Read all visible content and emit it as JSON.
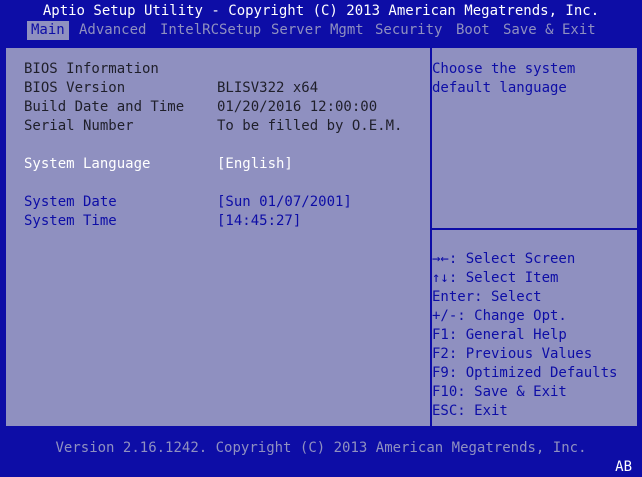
{
  "title": "Aptio Setup Utility - Copyright (C) 2013 American Megatrends, Inc.",
  "tabs": [
    "Main",
    "Advanced",
    "IntelRCSetup",
    "Server Mgmt",
    "Security",
    "Boot",
    "Save & Exit"
  ],
  "main": {
    "section_header": "BIOS Information",
    "bios_version_label": "BIOS Version",
    "bios_version_value": "BLISV322 x64",
    "build_date_label": "Build Date and Time",
    "build_date_value": "01/20/2016 12:00:00",
    "serial_label": "Serial Number",
    "serial_value": "To be filled by O.E.M.",
    "language_label": "System Language",
    "language_value": "[English]",
    "date_label": "System Date",
    "date_value": "[Sun 01/07/2001]",
    "time_label": "System Time",
    "time_value": "[14:45:27]"
  },
  "help": {
    "line1": "Choose the system",
    "line2": "default language"
  },
  "keys": [
    "→←: Select Screen",
    "↑↓: Select Item",
    "Enter: Select",
    "+/-: Change Opt.",
    "F1: General Help",
    "F2: Previous Values",
    "F9: Optimized Defaults",
    "F10: Save & Exit",
    "ESC: Exit"
  ],
  "footer": "Version 2.16.1242. Copyright (C) 2013 American Megatrends, Inc.",
  "corner": "AB",
  "colors": {
    "background": "#0d0da6",
    "panel": "#8f90c0",
    "selected_text": "#ffffff"
  }
}
